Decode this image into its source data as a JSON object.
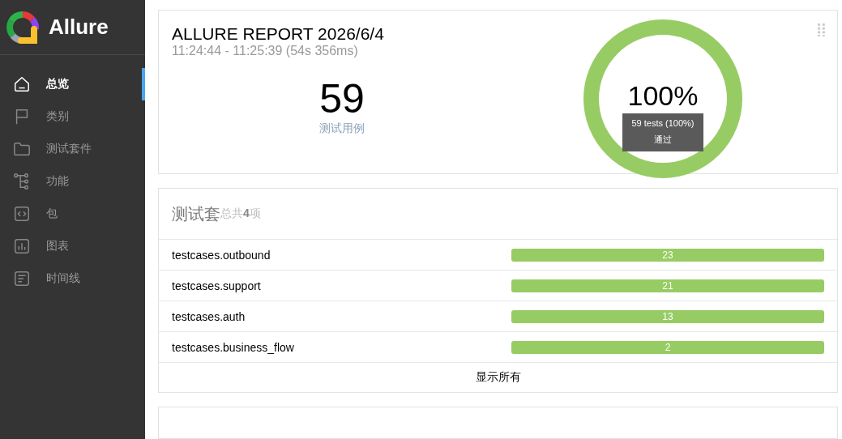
{
  "sidebar": {
    "brand": "Allure",
    "items": [
      {
        "label": "总览",
        "kind": "home",
        "selected": true
      },
      {
        "label": "类别",
        "kind": "flag",
        "selected": false
      },
      {
        "label": "测试套件",
        "kind": "folder",
        "selected": false
      },
      {
        "label": "功能",
        "kind": "tree",
        "selected": false
      },
      {
        "label": "包",
        "kind": "code",
        "selected": false
      },
      {
        "label": "图表",
        "kind": "chart",
        "selected": false
      },
      {
        "label": "时间线",
        "kind": "timeline",
        "selected": false
      }
    ]
  },
  "summary": {
    "title": "ALLURE REPORT 2026/6/4",
    "time_range": "11:24:44 - 11:25:39 (54s 356ms)",
    "test_count": "59",
    "test_count_label": "测试用例",
    "percent": "100%",
    "tooltip": {
      "line_1": "59 tests (100%)",
      "line_2": "通过"
    }
  },
  "suites": {
    "title": "测试套",
    "subtitle": "总共**4**项",
    "rows": [
      {
        "name": "testcases.outbound",
        "count": "23",
        "level": 1
      },
      {
        "name": "testcases.support",
        "count": "21",
        "level": 1
      },
      {
        "name": "testcases.auth",
        "count": "13",
        "level": 1
      },
      {
        "name": "testcases.business_flow",
        "count": "2",
        "level": 1
      }
    ],
    "show_all": "显示所有"
  }
}
